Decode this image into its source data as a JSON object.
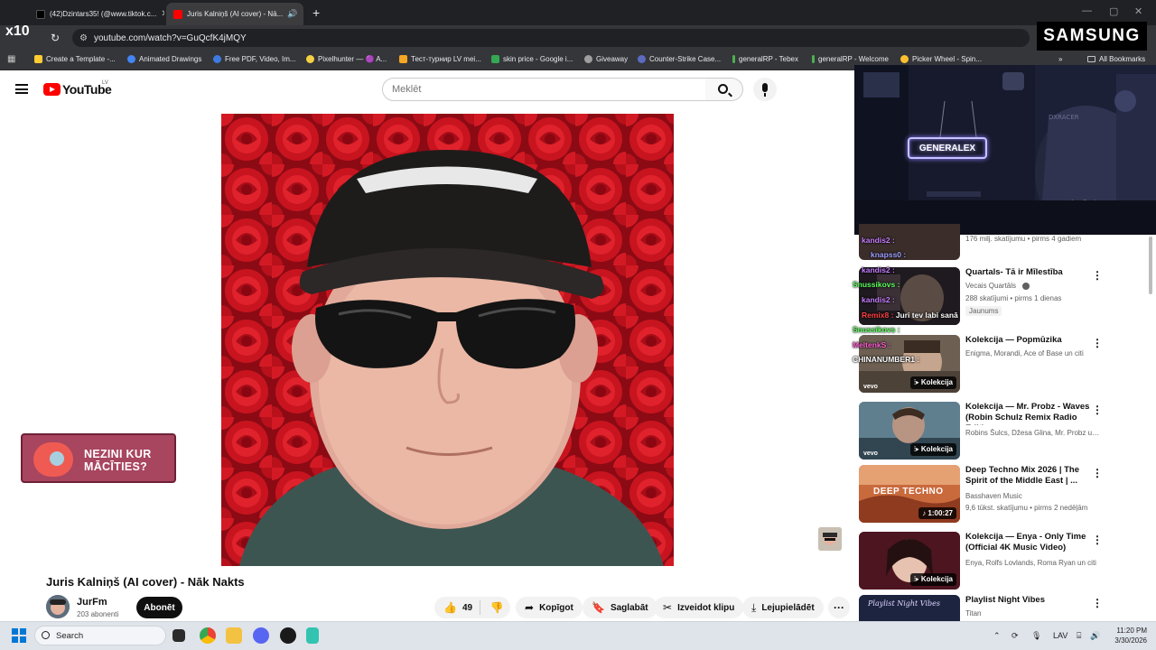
{
  "browser": {
    "tabs": [
      {
        "title": "(42)Dzintars35! (@www.tiktok.c...",
        "active": false
      },
      {
        "title": "Juris Kalniņš (AI cover) - Nā...",
        "active": true
      }
    ],
    "new_tab": "+",
    "url": "youtube.com/watch?v=GuQcfK4jMQY",
    "bookmarks": [
      {
        "label": "Create a Template -...",
        "color": "#ffcc33"
      },
      {
        "label": "Animated Drawings",
        "color": "#4285f4"
      },
      {
        "label": "Free PDF, Video, Im...",
        "color": "#3d7be0"
      },
      {
        "label": "Pixelhunter — 🟣 A...",
        "color": "#f5d142"
      },
      {
        "label": "Тест-турнир LV mei...",
        "color": "#f5a623"
      },
      {
        "label": "skin price - Google i...",
        "color": "#34a853"
      },
      {
        "label": "Giveaway",
        "color": "#9e9e9e"
      },
      {
        "label": "Counter-Strike Case...",
        "color": "#5c6bc0"
      },
      {
        "label": "generalRP - Tebex",
        "color": "#4caf50"
      },
      {
        "label": "generalRP - Welcome",
        "color": "#4caf50"
      },
      {
        "label": "Picker Wheel - Spin...",
        "color": "#fbc02d"
      }
    ],
    "all_bookmarks": "All Bookmarks"
  },
  "overlay": {
    "tiktok_multiplier": "x10",
    "sponsor": "SAMSUNG",
    "webcam_sign": "GENERALEX"
  },
  "youtube": {
    "logo_text": "YouTube",
    "region": "LV",
    "search_placeholder": "Meklēt",
    "video": {
      "title": "Juris Kalniņš (AI cover) - Nāk Nakts",
      "channel": "JurFm",
      "subscribers": "203 abonenti",
      "subscribe_label": "Abonēt",
      "likes": "49",
      "share_label": "Kopīgot",
      "save_label": "Saglabāt",
      "clip_label": "Izveidot klipu",
      "download_label": "Lejupielādēt"
    },
    "ad_banner": "NEZINI KUR MĀCĪTIES?",
    "recommendations": [
      {
        "title": "",
        "line1": "",
        "line2": "176 milj. skatījumu • pirms 4 gadiem",
        "badge": "",
        "tag": ""
      },
      {
        "title": "Quartals- Tā ir Mīlestība",
        "line1": "Vecais Quartāls",
        "line2": "288 skatījumi • pirms 1 dienas",
        "badge": "",
        "tag": "Jaunums"
      },
      {
        "title": "Kolekcija — Popmūzika",
        "line1": "Enigma, Morandi, Ace of Base un citi",
        "line2": "",
        "badge": "Kolekcija",
        "tag": ""
      },
      {
        "title": "Kolekcija — Mr. Probz - Waves (Robin Schulz Remix Radio Edit)",
        "line1": "Robins Šulcs, Džesa Glina, Mr. Probz un ...",
        "line2": "",
        "badge": "Kolekcija",
        "tag": ""
      },
      {
        "title": "Deep Techno Mix 2026 | The Spirit of the Middle East | ...",
        "line1": "Basshaven Music",
        "line2": "9,6 tūkst. skatījumu • pirms 2 nedēļām",
        "badge": "1:00:27",
        "tag": ""
      },
      {
        "title": "Kolekcija — Enya - Only Time (Official 4K Music Video)",
        "line1": "Enya, Rolfs Lovlands, Roma Ryan un citi",
        "line2": "",
        "badge": "Kolekcija",
        "tag": ""
      },
      {
        "title": "Playlist Night Vibes",
        "line1": "Titan",
        "line2": "",
        "badge": "",
        "tag": ""
      }
    ],
    "thumb_texts": {
      "deep_techno": "DEEP TECHNO",
      "vevo": "vevo"
    }
  },
  "chat": [
    {
      "user": "kandis2 :",
      "msg": "",
      "color": "#c77dff"
    },
    {
      "user": "knapss0 :",
      "msg": "",
      "color": "#a0a0ff"
    },
    {
      "user": "kandis2 :",
      "msg": "",
      "color": "#c77dff"
    },
    {
      "user": "Snussikovs :",
      "msg": "",
      "color": "#5eff5e"
    },
    {
      "user": "kandis2 :",
      "msg": "",
      "color": "#c77dff"
    },
    {
      "user": "Remix8 :",
      "msg": "Juri tev labi sanā",
      "color": "#ff4040"
    },
    {
      "user": "Snussikovs :",
      "msg": "",
      "color": "#5eff5e"
    },
    {
      "user": "MeltenkS :",
      "msg": "",
      "color": "#ff5fd0"
    },
    {
      "user": "CHINANUMBER1 :",
      "msg": "",
      "color": "#ffffff"
    }
  ],
  "taskbar": {
    "search_label": "Search",
    "language": "LAV",
    "time": "11:20 PM",
    "date": "3/30/2026"
  }
}
